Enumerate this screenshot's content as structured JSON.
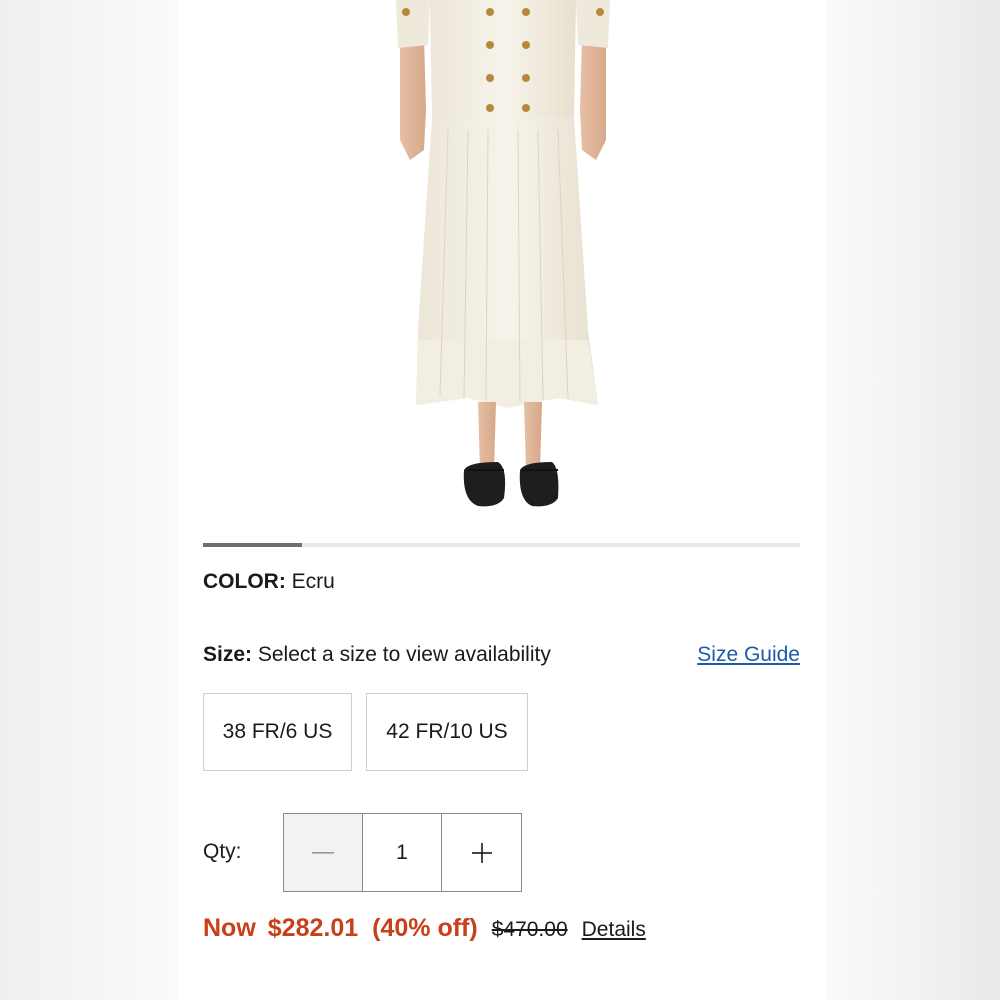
{
  "gallery": {
    "progress_fraction": 0.166
  },
  "color": {
    "label": "COLOR:",
    "value": "Ecru"
  },
  "size": {
    "label": "Size:",
    "prompt": "Select a size to view availability",
    "guide_link": "Size Guide",
    "options": [
      "38 FR/6 US",
      "42 FR/10 US"
    ]
  },
  "qty": {
    "label": "Qty:",
    "value": "1",
    "decrement_icon": "minus-icon",
    "increment_icon": "plus-icon"
  },
  "price": {
    "now": "Now",
    "sale_price": "$282.01",
    "discount": "(40% off)",
    "original_price": "$470.00",
    "details_link": "Details"
  },
  "colors": {
    "sale": "#c8401a",
    "link": "#1f5aa8"
  }
}
